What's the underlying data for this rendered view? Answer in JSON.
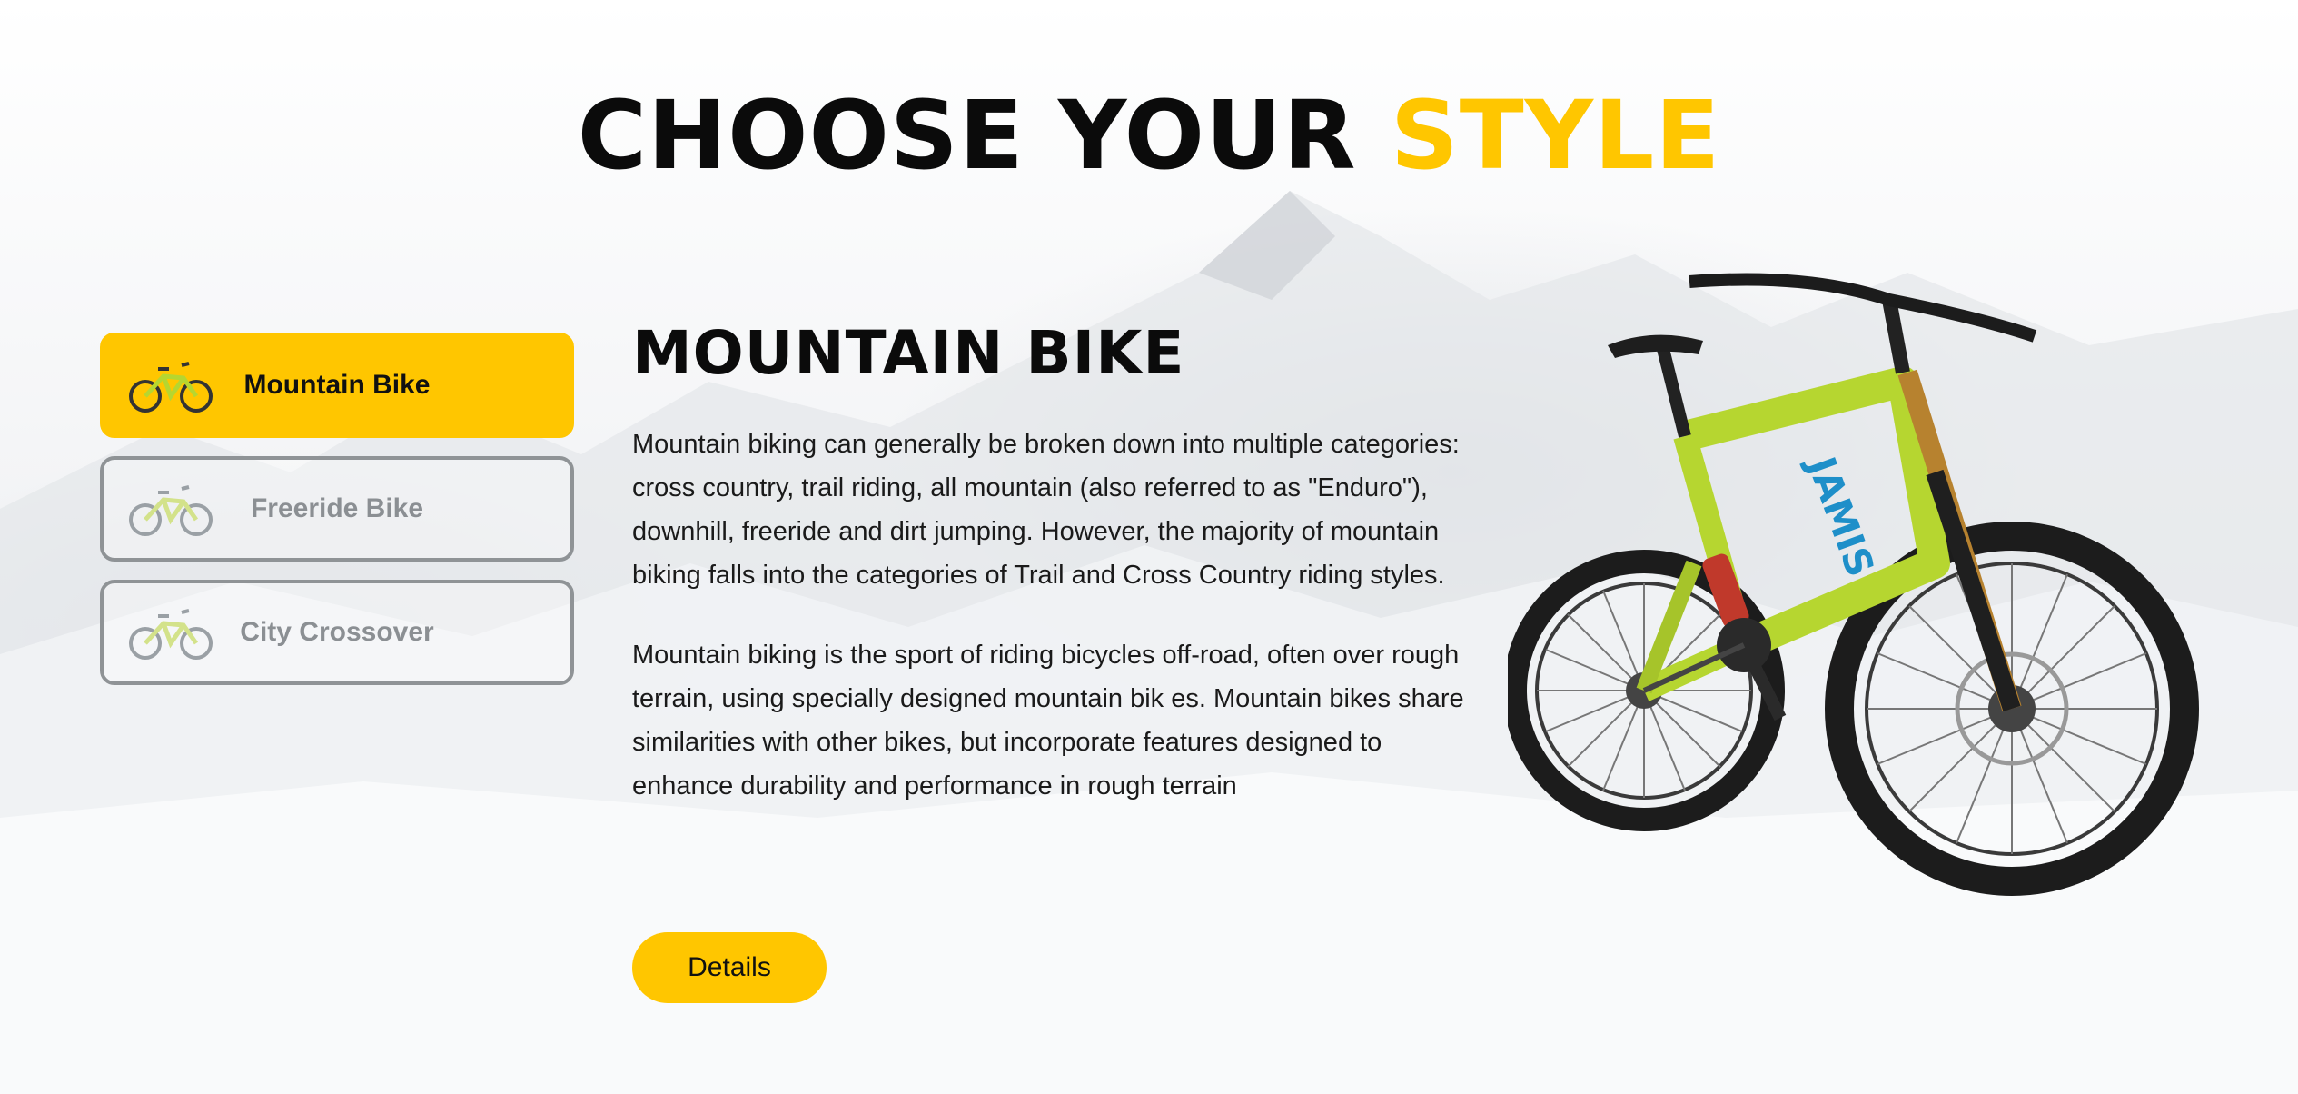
{
  "heading": {
    "part1": "CHOOSE YOUR ",
    "accent": "STYLE"
  },
  "tabs": [
    {
      "label": "Mountain Bike",
      "active": true,
      "icon": "bike-icon"
    },
    {
      "label": "Freeride Bike",
      "active": false,
      "icon": "bike-icon"
    },
    {
      "label": "City Crossover",
      "active": false,
      "icon": "bike-icon"
    }
  ],
  "content": {
    "title": "MOUNTAIN BIKE",
    "paragraph1": "Mountain biking can generally be broken down into multiple categories: cross country, trail riding, all mountain (also referred to as \"Enduro\"), downhill, freeride and dirt jumping. However, the majority of mountain biking falls into the categories of Trail and Cross Country riding styles.",
    "paragraph2": "Mountain biking is the sport of riding bicycles off-road, often over rough terrain, using specially designed mountain bik es. Mountain bikes share similarities with other bikes, but incorporate features designed to enhance durability and performance in rough terrain",
    "button_label": "Details"
  },
  "colors": {
    "accent": "#ffc600",
    "tab_border": "#8f9396",
    "bike_frame": "#b6d630",
    "bike_decal": "#1e8fc9"
  }
}
